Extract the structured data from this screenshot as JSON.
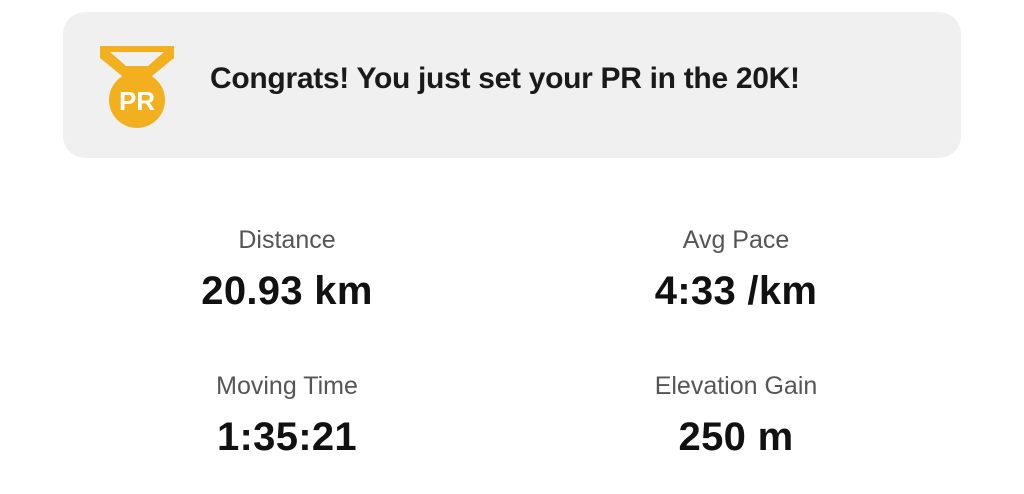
{
  "banner": {
    "icon": "pr-medal-icon",
    "badge_text": "PR",
    "message": "Congrats! You just set your PR in the 20K!",
    "accent_color": "#F2B01E"
  },
  "stats": [
    {
      "label": "Distance",
      "value": "20.93 km"
    },
    {
      "label": "Avg Pace",
      "value": "4:33 /km"
    },
    {
      "label": "Moving Time",
      "value": "1:35:21"
    },
    {
      "label": "Elevation Gain",
      "value": "250 m"
    }
  ]
}
